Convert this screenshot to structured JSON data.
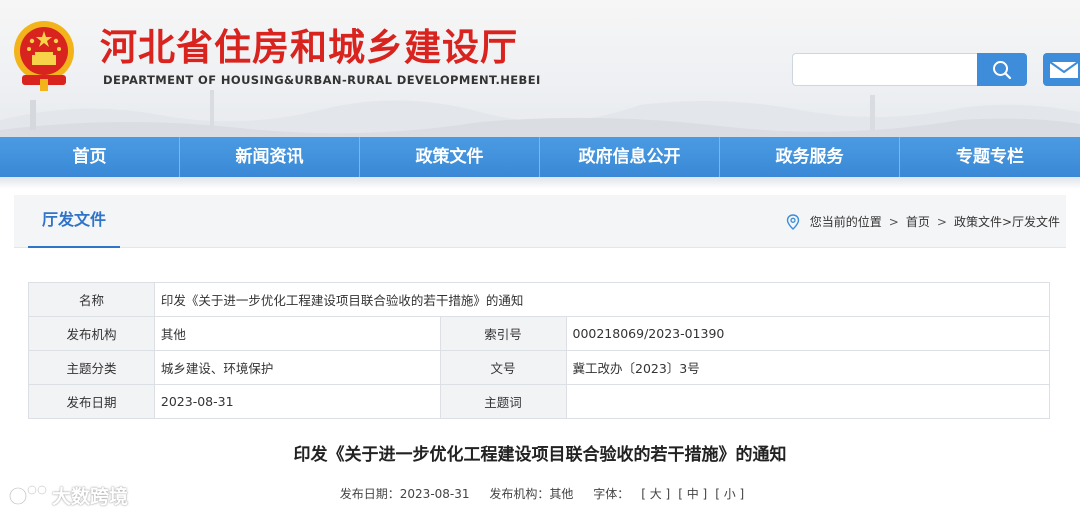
{
  "header": {
    "title": "河北省住房和城乡建设厅",
    "subtitle": "DEPARTMENT OF HOUSING&URBAN-RURAL DEVELOPMENT.HEBEI",
    "search_placeholder": "",
    "emblem_icon": "national-emblem-icon",
    "search_icon": "search-icon",
    "mail_icon": "mail-icon"
  },
  "nav": {
    "items": [
      "首页",
      "新闻资讯",
      "政策文件",
      "政府信息公开",
      "政务服务",
      "专题专栏"
    ]
  },
  "section": {
    "title": "厅发文件",
    "breadcrumb": {
      "location_label": "您当前的位置",
      "sep": ">",
      "home": "首页",
      "path": "政策文件>厅发文件"
    }
  },
  "meta": {
    "name_label": "名称",
    "name_value": "印发《关于进一步优化工程建设项目联合验收的若干措施》的通知",
    "org_label": "发布机构",
    "org_value": "其他",
    "index_label": "索引号",
    "index_value": "000218069/2023-01390",
    "category_label": "主题分类",
    "category_value": "城乡建设、环境保护",
    "doc_label": "文号",
    "doc_value": "冀工改办〔2023〕3号",
    "date_label": "发布日期",
    "date_value": "2023-08-31",
    "keyword_label": "主题词",
    "keyword_value": ""
  },
  "article": {
    "title": "印发《关于进一步优化工程建设项目联合验收的若干措施》的通知",
    "date_text": "发布日期：2023-08-31",
    "org_text": "发布机构：其他",
    "font_label": "字体：",
    "font_large": "[ 大 ]",
    "font_medium": "[ 中 ]",
    "font_small": "[ 小 ]"
  },
  "watermark": {
    "text": "大数跨境"
  },
  "colors": {
    "brand_red": "#d8231f",
    "nav_blue": "#3d8ddb",
    "accent_blue": "#2f74c8"
  }
}
